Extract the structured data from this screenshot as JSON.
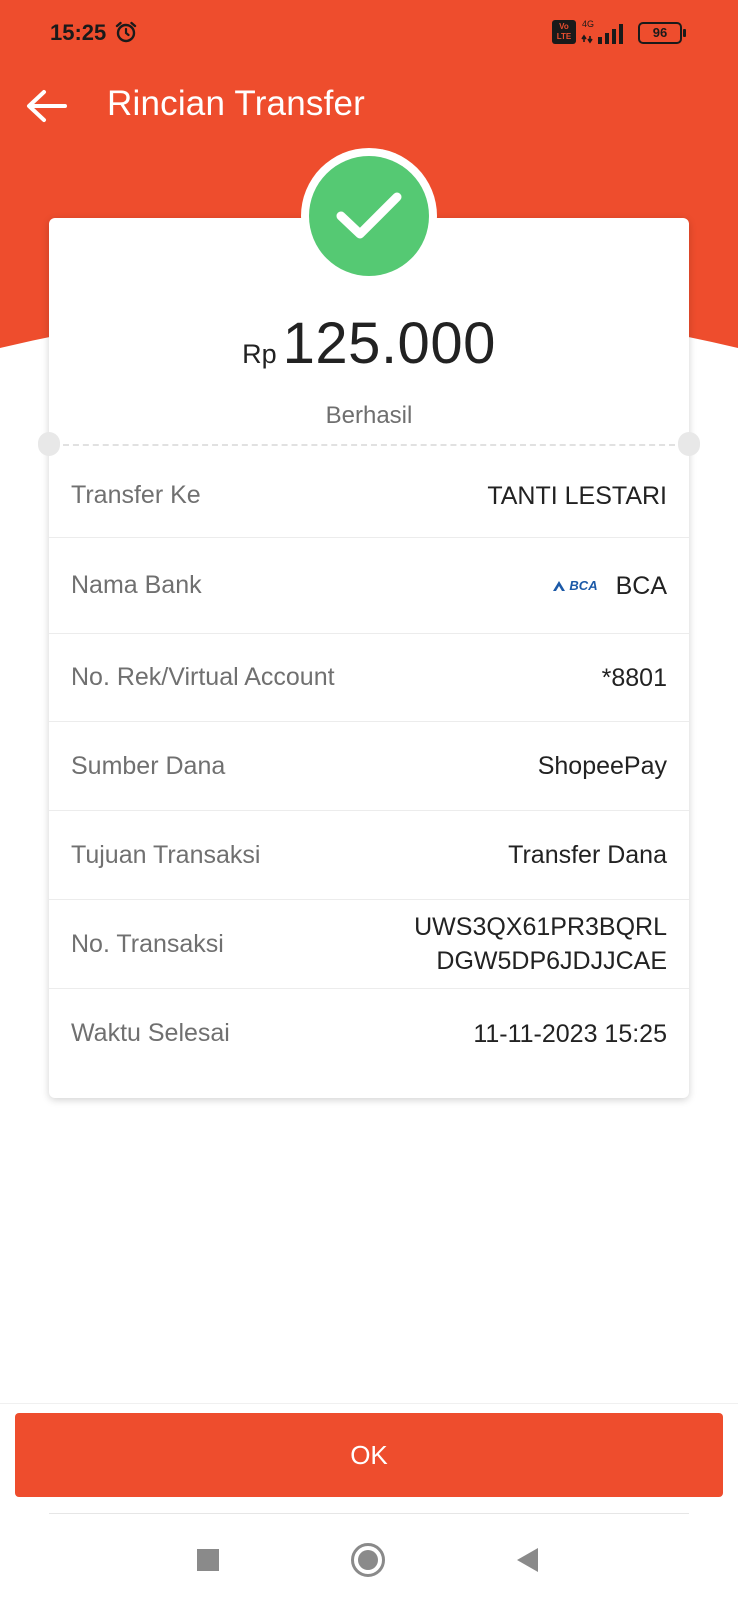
{
  "status_bar": {
    "time": "15:25",
    "network_label": "4G",
    "volte_label": "Vo LTE",
    "battery": "96"
  },
  "header": {
    "title": "Rincian Transfer",
    "back_icon": "arrow-left-icon"
  },
  "summary": {
    "currency": "Rp",
    "amount": "125.000",
    "status": "Berhasil",
    "status_icon": "checkmark-icon"
  },
  "details": [
    {
      "label": "Transfer Ke",
      "value": "TANTI LESTARI"
    },
    {
      "label": "Nama Bank",
      "value": "BCA",
      "logo_text": "BCA"
    },
    {
      "label": "No. Rek/Virtual Account",
      "value": "*8801"
    },
    {
      "label": "Sumber Dana",
      "value": "ShopeePay"
    },
    {
      "label": "Tujuan Transaksi",
      "value": "Transfer Dana"
    },
    {
      "label": "No. Transaksi",
      "value_line1": "UWS3QX61PR3BQRL",
      "value_line2": "DGW5DP6JDJJCAE"
    },
    {
      "label": "Waktu Selesai",
      "value": "11-11-2023 15:25"
    }
  ],
  "actions": {
    "ok_label": "OK"
  },
  "nav": {
    "recents_icon": "square-icon",
    "home_icon": "circle-icon",
    "back_icon": "triangle-back-icon"
  },
  "colors": {
    "header": "#ee4d2d",
    "success": "#55c973",
    "button": "#ee4d2d"
  }
}
